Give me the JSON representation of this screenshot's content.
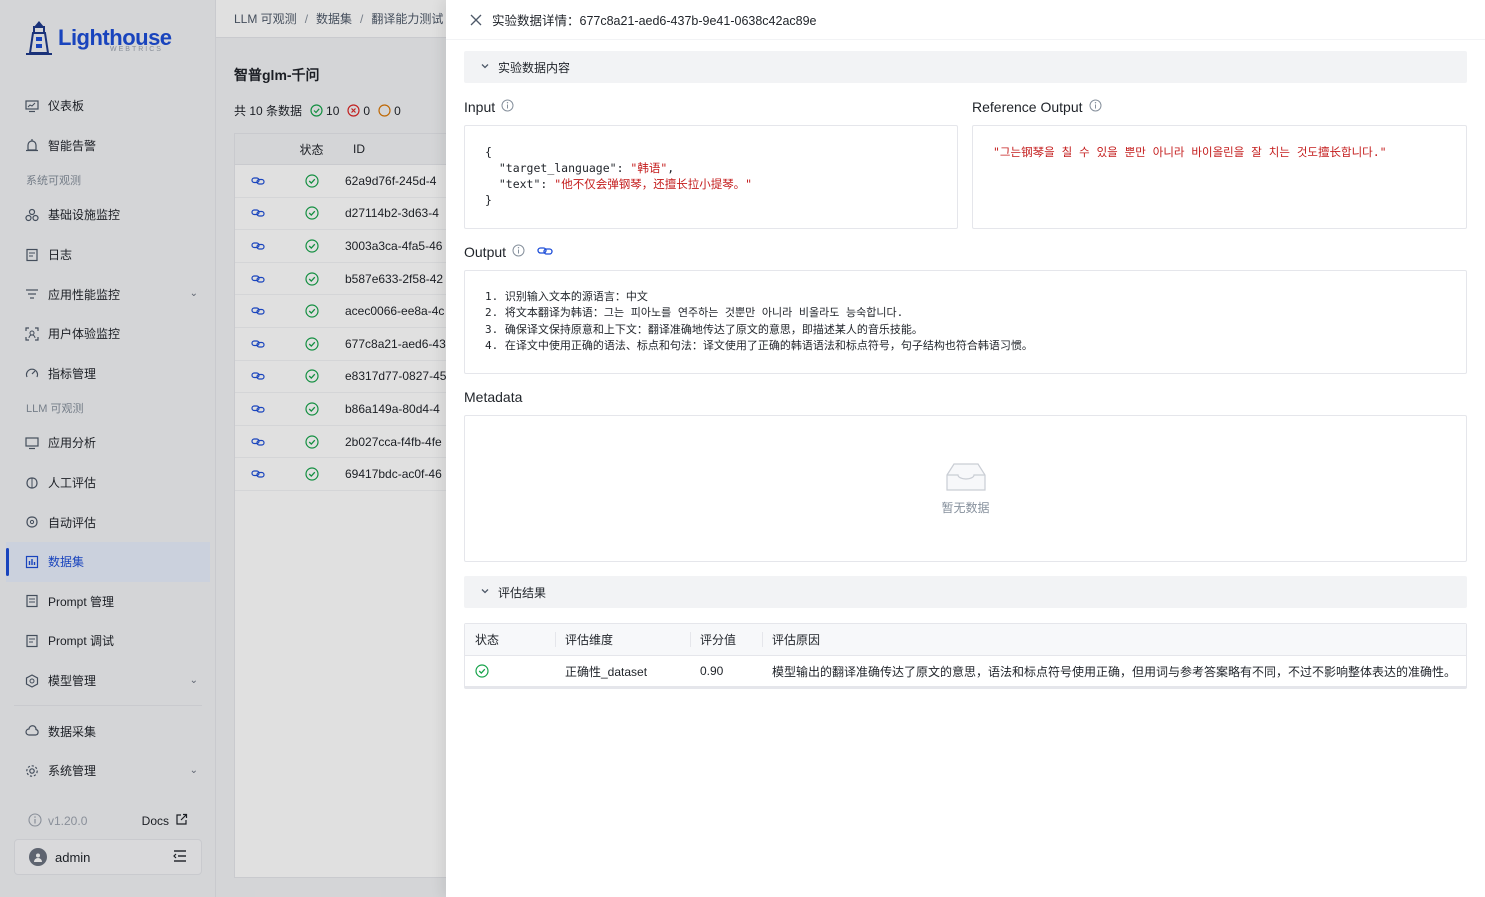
{
  "sidebar": {
    "logo": {
      "name": "Lighthouse",
      "sub": "WEBTRICS"
    },
    "items": [
      {
        "label": "仪表板",
        "icon": "monitor-icon"
      },
      {
        "label": "智能告警",
        "icon": "alarm-icon"
      },
      {
        "group": "系统可观测"
      },
      {
        "label": "基础设施监控",
        "icon": "nodes-icon"
      },
      {
        "label": "日志",
        "icon": "log-icon"
      },
      {
        "label": "应用性能监控",
        "icon": "list-filter-icon",
        "expandable": true
      },
      {
        "label": "用户体验监控",
        "icon": "user-scan-icon"
      },
      {
        "label": "指标管理",
        "icon": "gauge-icon"
      },
      {
        "group": "LLM 可观测"
      },
      {
        "label": "应用分析",
        "icon": "monitor-chart-icon"
      },
      {
        "label": "人工评估",
        "icon": "brain-icon"
      },
      {
        "label": "自动评估",
        "icon": "brain-gear-icon"
      },
      {
        "label": "数据集",
        "icon": "bar-chart-icon",
        "active": true
      },
      {
        "label": "Prompt 管理",
        "icon": "document-icon"
      },
      {
        "label": "Prompt 调试",
        "icon": "document-edit-icon"
      },
      {
        "label": "模型管理",
        "icon": "hexagon-icon",
        "expandable": true
      },
      {
        "divider": true
      },
      {
        "label": "数据采集",
        "icon": "cloud-icon"
      },
      {
        "label": "系统管理",
        "icon": "gear-icon",
        "expandable": true
      }
    ],
    "version": "v1.20.0",
    "docs_label": "Docs",
    "user": "admin"
  },
  "main": {
    "breadcrumb": [
      "LLM 可观测",
      "数据集",
      "翻译能力测试"
    ],
    "page_title": "智普glm-千问",
    "stats": {
      "total_text": "共 10 条数据",
      "success": "10",
      "failed": "0",
      "pending": "0"
    },
    "table": {
      "headers": [
        "状态",
        "ID"
      ],
      "rows": [
        "62a9d76f-245d-4",
        "d27114b2-3d63-4",
        "3003a3ca-4fa5-46",
        "b587e633-2f58-42",
        "acec0066-ee8a-4c",
        "677c8a21-aed6-43",
        "e8317d77-0827-45",
        "b86a149a-80d4-4",
        "2b027cca-f4fb-4fe",
        "69417bdc-ac0f-46"
      ]
    }
  },
  "drawer": {
    "title": "实验数据详情：677c8a21-aed6-437b-9e41-0638c42ac89e",
    "content_section": "实验数据内容",
    "input_label": "Input",
    "input_json": {
      "open": "{",
      "key1": "\"target_language\"",
      "val1": "\"韩语\"",
      "key2": "\"text\"",
      "val2": "\"他不仅会弹钢琴，还擅长拉小提琴。\"",
      "close": "}"
    },
    "reference_label": "Reference Output",
    "reference_value": "\"그는钢琴을 칠 수 있을 뿐만 아니라 바이올린을 잘 치는 것도擅长합니다.\"",
    "output_label": "Output",
    "output_lines": [
      "1. 识别输入文本的源语言：中文",
      "2. 将文本翻译为韩语：그는 피아노를 연주하는 것뿐만 아니라 비올라도 능숙합니다.",
      "3. 确保译文保持原意和上下文：翻译准确地传达了原文的意思，即描述某人的音乐技能。",
      "4. 在译文中使用正确的语法、标点和句法：译文使用了正确的韩语语法和标点符号，句子结构也符合韩语习惯。"
    ],
    "metadata_label": "Metadata",
    "empty_text": "暂无数据",
    "eval_section": "评估结果",
    "eval_table": {
      "headers": [
        "状态",
        "评估维度",
        "评分值",
        "评估原因"
      ],
      "rows": [
        {
          "dimension": "正确性_dataset",
          "score": "0.90",
          "reason": "模型输出的翻译准确传达了原文的意思，语法和标点符号使用正确，但用词与参考答案略有不同，不过不影响整体表达的准确性。"
        }
      ]
    }
  },
  "colors": {
    "accent": "#1d4ed8",
    "success": "#16a34a",
    "error": "#dc2626",
    "warning": "#d97706",
    "string": "#c41d1d"
  }
}
